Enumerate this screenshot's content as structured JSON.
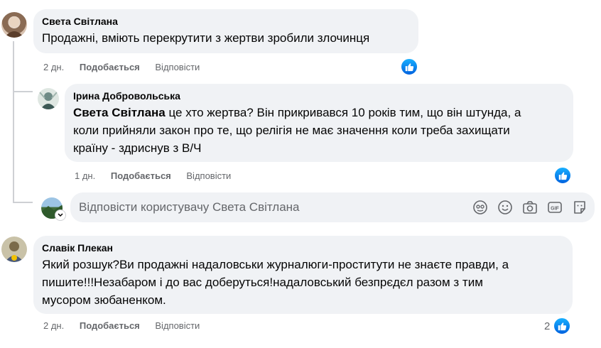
{
  "comments": [
    {
      "author": "Света Світлана",
      "text": "Продажні, вміють перекрутити з жертви зробили злочинця",
      "time": "2 дн.",
      "like_label": "Подобається",
      "reply_label": "Відповісти"
    },
    {
      "author": "Ірина Добровольська",
      "mention": "Света Світлана",
      "text_line1": " це хто жертва? Він прикривався 10 років тим, що він штунда, а",
      "text_line2": "коли прийняли закон про те, що релігія не має значення коли треба захищати",
      "text_line3": "країну - здриснув з В/Ч",
      "time": "1 дн.",
      "like_label": "Подобається",
      "reply_label": "Відповісти"
    },
    {
      "author": "Славік Плекан",
      "text_line1": "Який розшук?Ви продажні надаловськи журналюги-проститути не знаєте правди, а",
      "text_line2": "пишите!!!Незабаром і до вас доберуться!надаловський безпрєдєл разом з тим",
      "text_line3": "мусором зюбаненком.",
      "time": "2 дн.",
      "like_label": "Подобається",
      "reply_label": "Відповісти",
      "reaction_count": "2"
    }
  ],
  "reply_box": {
    "placeholder": "Відповісти користувачу Света Світлана"
  },
  "icons": [
    "avatar-icon",
    "emoji-icon",
    "camera-icon",
    "gif-icon",
    "sticker-icon",
    "like-reaction-icon"
  ],
  "colors": {
    "accent": "#1877f2",
    "bubble": "#f0f2f5",
    "meta": "#65676b"
  }
}
